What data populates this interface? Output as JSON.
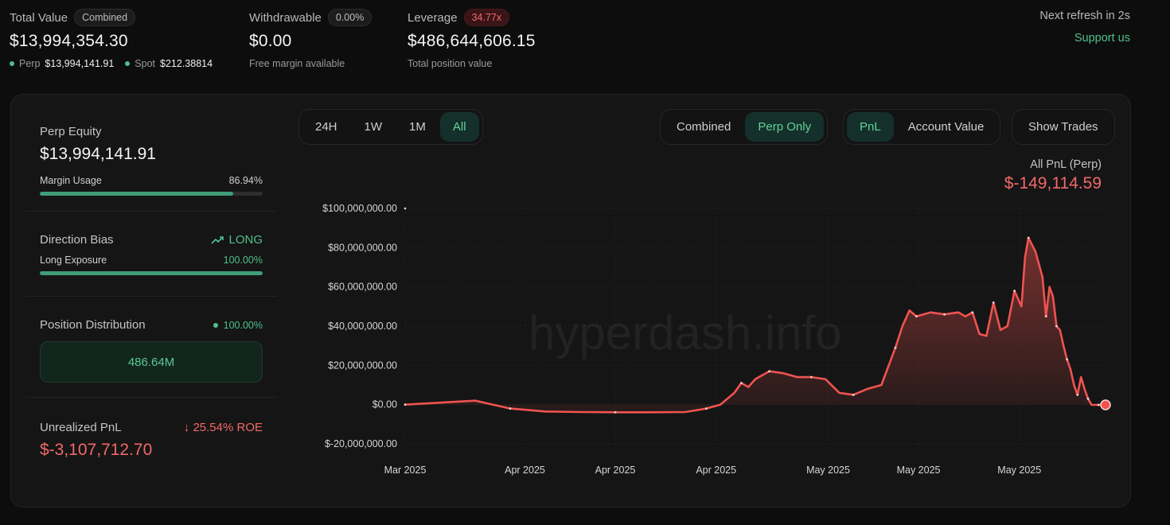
{
  "header": {
    "total_value": {
      "label": "Total Value",
      "pill": "Combined",
      "value": "$13,994,354.30",
      "perp_label": "Perp",
      "perp_value": "$13,994,141.91",
      "spot_label": "Spot",
      "spot_value": "$212.38814"
    },
    "withdrawable": {
      "label": "Withdrawable",
      "pill": "0.00%",
      "value": "$0.00",
      "sub": "Free margin available"
    },
    "leverage": {
      "label": "Leverage",
      "pill": "34.77x",
      "value": "$486,644,606.15",
      "sub": "Total position value"
    },
    "refresh": "Next refresh in 2s",
    "support": "Support us"
  },
  "left_panel": {
    "perp_equity": {
      "label": "Perp Equity",
      "value": "$13,994,141.91",
      "margin_label": "Margin Usage",
      "margin_value": "86.94%",
      "margin_fraction": 0.8694
    },
    "direction": {
      "label": "Direction Bias",
      "bias": "LONG",
      "exposure_label": "Long Exposure",
      "exposure_value": "100.00%",
      "exposure_fraction": 1.0
    },
    "distribution": {
      "label": "Position Distribution",
      "value": "100.00%",
      "box": "486.64M"
    },
    "unrealized": {
      "label": "Unrealized PnL",
      "roe": "25.54% ROE",
      "value": "$-3,107,712.70"
    }
  },
  "controls": {
    "ranges": [
      {
        "label": "24H",
        "active": false
      },
      {
        "label": "1W",
        "active": false
      },
      {
        "label": "1M",
        "active": false
      },
      {
        "label": "All",
        "active": true
      }
    ],
    "modes": [
      {
        "label": "Combined",
        "active": false
      },
      {
        "label": "Perp Only",
        "active": true
      }
    ],
    "metrics": [
      {
        "label": "PnL",
        "active": true
      },
      {
        "label": "Account Value",
        "active": false
      }
    ],
    "show_trades": "Show Trades"
  },
  "pnl_caption": {
    "label": "All PnL (Perp)",
    "value": "$-149,114.59"
  },
  "colors": {
    "accent_green": "#4fc08d",
    "line_red": "#ef5350"
  },
  "chart_data": {
    "type": "area",
    "title": "",
    "xlabel": "",
    "ylabel": "",
    "watermark": "hyperdash.info",
    "ylim": [
      -20000000,
      100000000
    ],
    "y_ticks": [
      100000000,
      80000000,
      60000000,
      40000000,
      20000000,
      0,
      -20000000
    ],
    "y_tick_labels": [
      "$100,000,000.00",
      "$80,000,000.00",
      "$60,000,000.00",
      "$40,000,000.00",
      "$20,000,000.00",
      "$0.00",
      "$-20,000,000.00"
    ],
    "x_tick_labels": [
      "Mar 2025",
      "Apr 2025",
      "Apr 2025",
      "Apr 2025",
      "May 2025",
      "May 2025",
      "May 2025"
    ],
    "x_tick_positions": [
      0.0,
      0.171,
      0.3,
      0.444,
      0.604,
      0.733,
      0.877
    ],
    "grid": true,
    "series": [
      {
        "x": [
          0.0,
          0.05,
          0.1,
          0.15,
          0.2,
          0.25,
          0.3,
          0.35,
          0.4,
          0.43,
          0.45,
          0.47,
          0.48,
          0.49,
          0.5,
          0.52,
          0.54,
          0.56,
          0.58,
          0.6,
          0.62,
          0.64,
          0.66,
          0.68,
          0.7,
          0.71,
          0.72,
          0.73,
          0.74,
          0.75,
          0.77,
          0.79,
          0.8,
          0.81,
          0.82,
          0.83,
          0.84,
          0.85,
          0.86,
          0.87,
          0.88,
          0.885,
          0.89,
          0.9,
          0.91,
          0.915,
          0.92,
          0.925,
          0.93,
          0.935,
          0.94,
          0.945,
          0.95,
          0.955,
          0.96,
          0.965,
          0.97,
          0.975,
          0.98,
          0.985,
          0.99,
          0.995,
          1.0
        ],
        "values": [
          0,
          1000000,
          2000000,
          -2000000,
          -3500000,
          -3800000,
          -3900000,
          -3900000,
          -3800000,
          -2000000,
          0,
          6000000,
          11000000,
          9000000,
          13000000,
          17000000,
          16000000,
          14000000,
          14000000,
          13000000,
          6000000,
          5000000,
          8000000,
          10000000,
          29000000,
          40000000,
          48000000,
          45000000,
          46000000,
          47000000,
          46000000,
          47000000,
          45000000,
          47000000,
          36000000,
          35000000,
          52000000,
          38000000,
          40000000,
          58000000,
          50000000,
          75000000,
          85000000,
          78000000,
          65000000,
          45000000,
          60000000,
          55000000,
          40000000,
          38000000,
          30000000,
          23000000,
          18000000,
          10000000,
          5000000,
          14000000,
          8000000,
          3000000,
          -150000,
          -149114.59,
          -149114.59,
          -149114.59,
          -149114.59
        ]
      }
    ]
  }
}
